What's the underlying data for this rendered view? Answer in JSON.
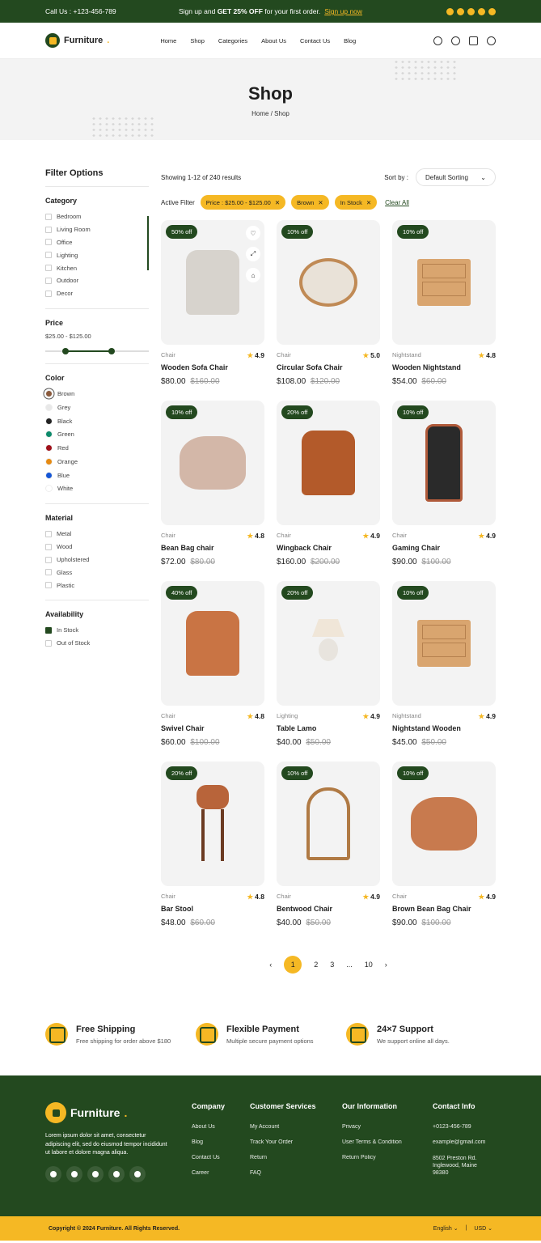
{
  "topbar": {
    "call": "Call Us : +123-456-789",
    "promo_a": "Sign up and ",
    "promo_b": "GET 25% OFF",
    "promo_c": " for your first order.",
    "promo_link": "Sign up now"
  },
  "brand": "Furniture",
  "nav": [
    "Home",
    "Shop",
    "Categories",
    "About Us",
    "Contact Us",
    "Blog"
  ],
  "hero": {
    "title": "Shop",
    "crumb_home": "Home",
    "crumb_sep": "/",
    "crumb_cur": "Shop"
  },
  "filters": {
    "title": "Filter Options",
    "category": {
      "title": "Category",
      "items": [
        "Bedroom",
        "Living Room",
        "Office",
        "Lighting",
        "Kitchen",
        "Outdoor",
        "Decor"
      ]
    },
    "price": {
      "title": "Price",
      "range": "$25.00 - $125.00"
    },
    "color": {
      "title": "Color",
      "items": [
        {
          "n": "Brown",
          "c": "#8b5a3c"
        },
        {
          "n": "Grey",
          "c": "#e8e8e8"
        },
        {
          "n": "Black",
          "c": "#222222"
        },
        {
          "n": "Green",
          "c": "#0d8a6b"
        },
        {
          "n": "Red",
          "c": "#a0101a"
        },
        {
          "n": "Orange",
          "c": "#e68a12"
        },
        {
          "n": "Blue",
          "c": "#1556d6"
        },
        {
          "n": "White",
          "c": "#ffffff"
        }
      ]
    },
    "material": {
      "title": "Material",
      "items": [
        "Metal",
        "Wood",
        "Upholstered",
        "Glass",
        "Plastic"
      ]
    },
    "availability": {
      "title": "Availability",
      "items": [
        "In Stock",
        "Out of Stock"
      ]
    }
  },
  "results": {
    "showing": "Showing 1-12 of 240 results",
    "sort_label": "Sort by :",
    "sort_value": "Default Sorting"
  },
  "active_filter": {
    "label": "Active Filter",
    "chips": [
      "Price : $25.00 - $125.00",
      "Brown",
      "In Stock"
    ],
    "clear": "Clear All"
  },
  "products": [
    {
      "badge": "50% off",
      "cat": "Chair",
      "rating": "4.9",
      "name": "Wooden Sofa Chair",
      "price": "$80.00",
      "old": "$160.00"
    },
    {
      "badge": "10% off",
      "cat": "Chair",
      "rating": "5.0",
      "name": "Circular Sofa Chair",
      "price": "$108.00",
      "old": "$120.00"
    },
    {
      "badge": "10% off",
      "cat": "Nightstand",
      "rating": "4.8",
      "name": "Wooden Nightstand",
      "price": "$54.00",
      "old": "$60.00"
    },
    {
      "badge": "10% off",
      "cat": "Chair",
      "rating": "4.8",
      "name": "Bean Bag chair",
      "price": "$72.00",
      "old": "$80.00"
    },
    {
      "badge": "20% off",
      "cat": "Chair",
      "rating": "4.9",
      "name": "Wingback Chair",
      "price": "$160.00",
      "old": "$200.00"
    },
    {
      "badge": "10% off",
      "cat": "Chair",
      "rating": "4.9",
      "name": "Gaming Chair",
      "price": "$90.00",
      "old": "$100.00"
    },
    {
      "badge": "40% off",
      "cat": "Chair",
      "rating": "4.8",
      "name": "Swivel Chair",
      "price": "$60.00",
      "old": "$100.00"
    },
    {
      "badge": "20% off",
      "cat": "Lighting",
      "rating": "4.9",
      "name": "Table Lamo",
      "price": "$40.00",
      "old": "$50.00"
    },
    {
      "badge": "10% off",
      "cat": "Nightstand",
      "rating": "4.9",
      "name": "Nightstand Wooden",
      "price": "$45.00",
      "old": "$50.00"
    },
    {
      "badge": "20% off",
      "cat": "Chair",
      "rating": "4.8",
      "name": "Bar Stool",
      "price": "$48.00",
      "old": "$60.00"
    },
    {
      "badge": "10% off",
      "cat": "Chair",
      "rating": "4.9",
      "name": "Bentwood Chair",
      "price": "$40.00",
      "old": "$50.00"
    },
    {
      "badge": "10% off",
      "cat": "Chair",
      "rating": "4.9",
      "name": "Brown Bean Bag Chair",
      "price": "$90.00",
      "old": "$100.00"
    }
  ],
  "pagination": {
    "pages": [
      "1",
      "2",
      "3",
      "...",
      "10"
    ]
  },
  "features": [
    {
      "t": "Free Shipping",
      "d": "Free shipping for order above $180"
    },
    {
      "t": "Flexible Payment",
      "d": "Multiple secure payment options"
    },
    {
      "t": "24×7 Support",
      "d": "We support online all days."
    }
  ],
  "footer": {
    "about": "Lorem ipsum dolor sit amet, consectetur adipiscing elit, sed do eiusmod tempor incididunt ut labore et dolore magna aliqua.",
    "cols": [
      {
        "t": "Company",
        "l": [
          "About Us",
          "Blog",
          "Contact Us",
          "Career"
        ]
      },
      {
        "t": "Customer Services",
        "l": [
          "My Account",
          "Track Your Order",
          "Return",
          "FAQ"
        ]
      },
      {
        "t": "Our Information",
        "l": [
          "Privacy",
          "User Terms & Condition",
          "Return Policy"
        ]
      },
      {
        "t": "Contact Info",
        "l": [
          "+0123-456-789",
          "example@gmail.com",
          "8502 Preston Rd. Inglewood, Maine 98380"
        ]
      }
    ],
    "copyright": "Copyright © 2024 Furniture. All Rights Reserved.",
    "lang": "English",
    "currency": "USD"
  },
  "colors": {
    "green": "#23491f",
    "yellow": "#f5b824"
  }
}
